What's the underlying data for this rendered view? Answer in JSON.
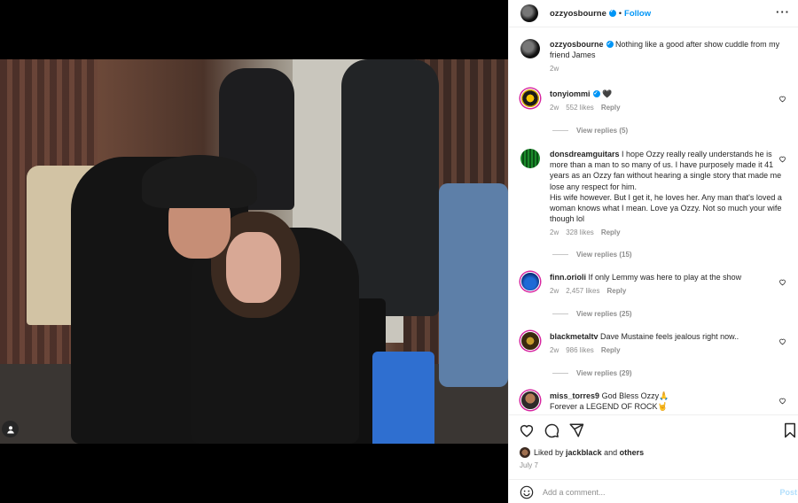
{
  "header": {
    "username": "ozzyosbourne",
    "dot": "•",
    "follow": "Follow",
    "more": "···"
  },
  "caption": {
    "username": "ozzyosbourne",
    "text": "Nothing like a good after show cuddle from my friend James",
    "time": "2w"
  },
  "comments": [
    {
      "username": "tonyiommi",
      "text": "🖤",
      "time": "2w",
      "likes": "552 likes",
      "reply": "Reply",
      "view_replies": "View replies (5)"
    },
    {
      "username": "donsdreamguitars",
      "text": "I hope Ozzy really really understands he is more than a man to so many of us. I have purposely made it 41 years as an Ozzy fan without hearing a single story that made me lose any respect for him.",
      "text2": "His wife however. But I get it, he loves her. Any man that's loved a woman knows what I mean. Love ya Ozzy. Not so much your wife though lol",
      "time": "2w",
      "likes": "328 likes",
      "reply": "Reply",
      "view_replies": "View replies (15)"
    },
    {
      "username": "finn.orioli",
      "text": "If only Lemmy was here to play at the show",
      "time": "2w",
      "likes": "2,457 likes",
      "reply": "Reply",
      "view_replies": "View replies (25)"
    },
    {
      "username": "blackmetaltv",
      "text": "Dave Mustaine feels jealous right now..",
      "time": "2w",
      "likes": "986 likes",
      "reply": "Reply",
      "view_replies": "View replies (29)"
    },
    {
      "username": "miss_torres9",
      "text": "God Bless Ozzy🙏",
      "text2": "Forever a LEGEND OF ROCK🤘"
    }
  ],
  "liked_by": {
    "prefix": "Liked by",
    "user": "jackblack",
    "and": "and",
    "others": "others"
  },
  "date": "July 7",
  "add_comment": {
    "placeholder": "Add a comment...",
    "post": "Post"
  },
  "icons": [
    "user-tag-icon",
    "heart-icon",
    "comment-icon",
    "share-icon",
    "bookmark-icon",
    "emoji-icon",
    "more-icon",
    "verified-icon"
  ],
  "colors": {
    "accent": "#0095f6",
    "muted": "#8e8e8e",
    "post_disabled": "#b2dffc"
  }
}
